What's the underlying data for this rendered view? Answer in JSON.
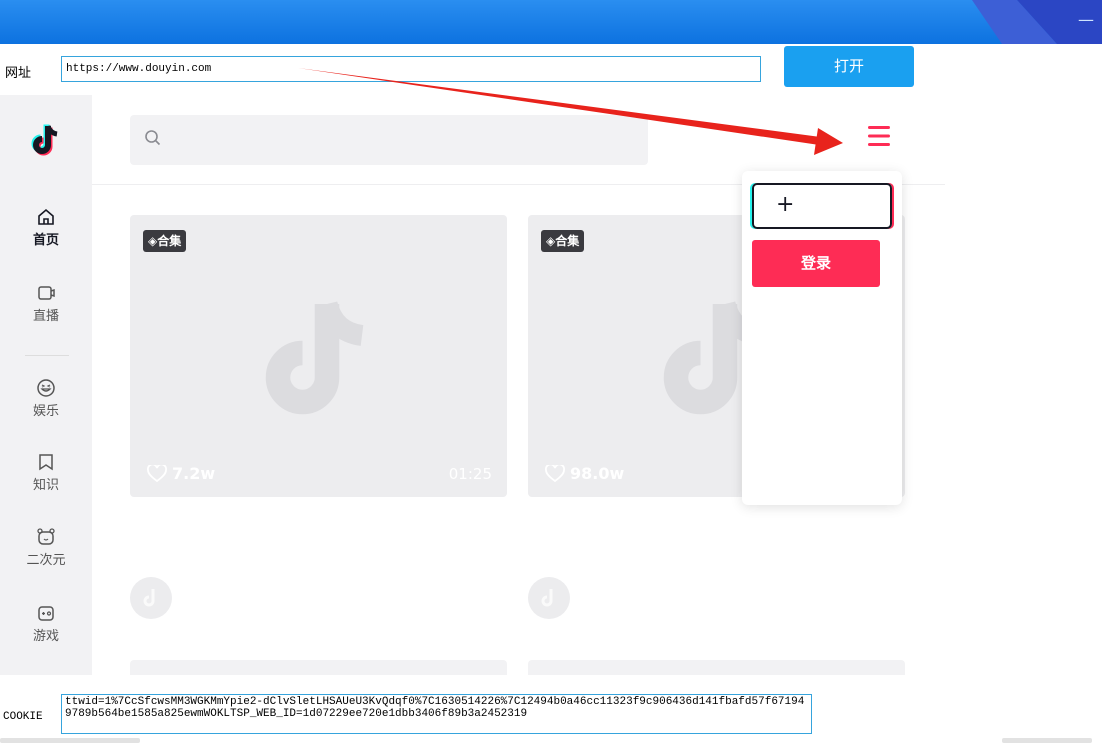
{
  "titlebar": {
    "minimize_label": "—"
  },
  "url_row": {
    "label": "网址",
    "value": "https://www.douyin.com",
    "open_label": "打开"
  },
  "sidebar": {
    "items": [
      {
        "label": "首页",
        "icon": "home-icon",
        "active": true
      },
      {
        "label": "直播",
        "icon": "live-icon"
      },
      {
        "label": "娱乐",
        "icon": "entertainment-icon"
      },
      {
        "label": "知识",
        "icon": "knowledge-icon"
      },
      {
        "label": "二次元",
        "icon": "anime-icon"
      },
      {
        "label": "游戏",
        "icon": "game-icon"
      }
    ]
  },
  "cards": [
    {
      "tag": "合集",
      "likes": "7.2w",
      "duration": "01:25"
    },
    {
      "tag": "合集",
      "likes": "98.0w"
    }
  ],
  "popup": {
    "plus_label": "+",
    "login_label": "登录"
  },
  "cookie": {
    "label": "COOKIE",
    "value": "ttwid=1%7CcSfcwsMM3WGKMmYpie2-dClvSletLHSAUeU3KvQdqf0%7C1630514226%7C12494b0a46cc11323f9c906436d141fbafd57f671949789b564be1585a825ewmWOKLTSP_WEB_ID=1d07229ee720e1dbb3406f89b3a2452319"
  },
  "colors": {
    "accent": "#fe2c55",
    "open_button": "#1aa0f0",
    "arrow": "#e8231c"
  }
}
